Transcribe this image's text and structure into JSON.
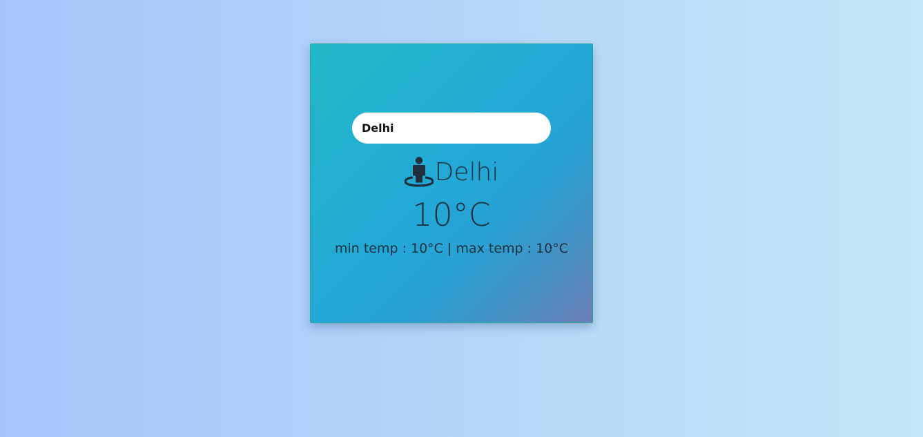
{
  "search": {
    "value": "Delhi"
  },
  "weather": {
    "city_icon": "street-view-icon",
    "city": "Delhi",
    "temp": "10°C",
    "min_label": "min temp : 10°C",
    "separator": " | ",
    "max_label": "max temp : 10°C"
  },
  "colors": {
    "background_left": "#a4c5fb",
    "background_right": "#c2e7f8",
    "card_start": "#22b9c6",
    "card_end": "#6c7db6",
    "text": "#1f2f3e"
  }
}
